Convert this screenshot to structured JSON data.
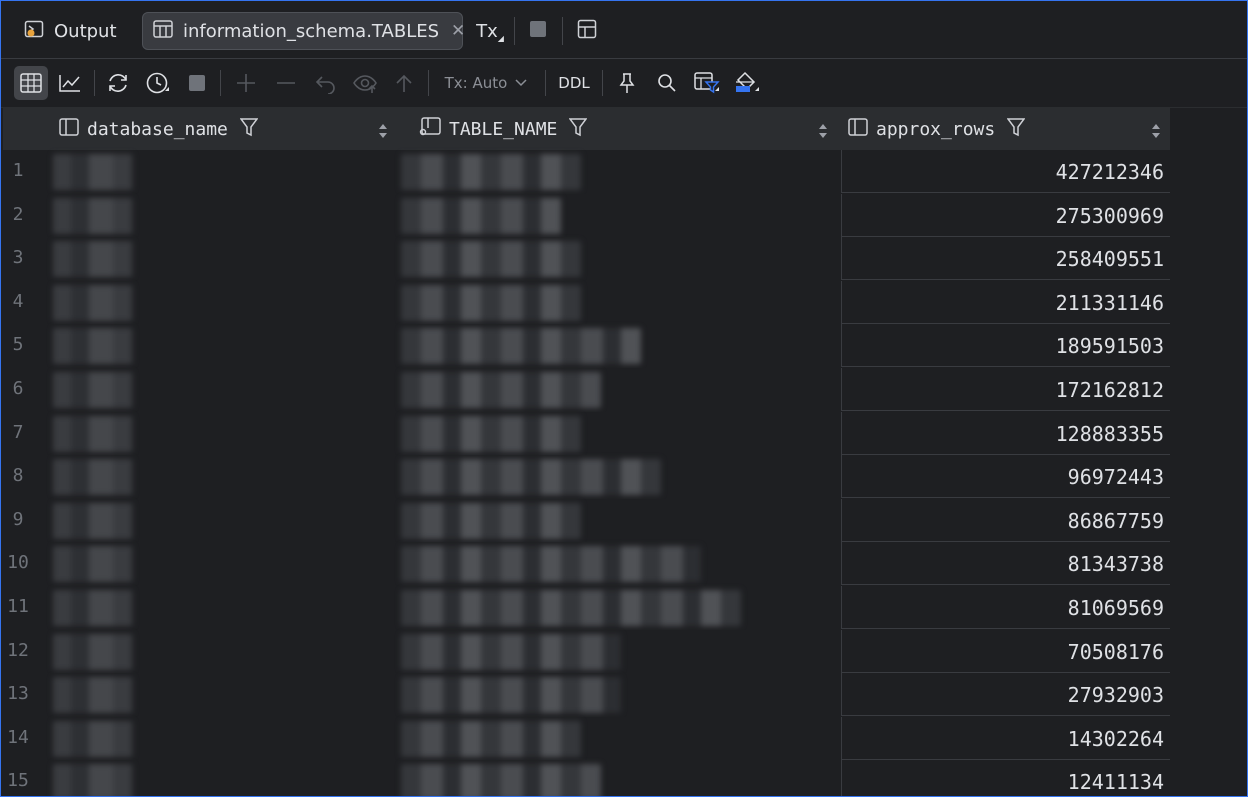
{
  "tabs": {
    "output_label": "Output",
    "active_label": "information_schema.TABLES",
    "tx_label": "Tx"
  },
  "toolbar": {
    "tx_mode": "Tx: Auto",
    "ddl_label": "DDL"
  },
  "columns": [
    {
      "name": "database_name"
    },
    {
      "name": "TABLE_NAME"
    },
    {
      "name": "approx_rows"
    }
  ],
  "rows": [
    {
      "num": "1",
      "approx_rows": "427212346"
    },
    {
      "num": "2",
      "approx_rows": "275300969"
    },
    {
      "num": "3",
      "approx_rows": "258409551"
    },
    {
      "num": "4",
      "approx_rows": "211331146"
    },
    {
      "num": "5",
      "approx_rows": "189591503"
    },
    {
      "num": "6",
      "approx_rows": "172162812"
    },
    {
      "num": "7",
      "approx_rows": "128883355"
    },
    {
      "num": "8",
      "approx_rows": "96972443"
    },
    {
      "num": "9",
      "approx_rows": "86867759"
    },
    {
      "num": "10",
      "approx_rows": "81343738"
    },
    {
      "num": "11",
      "approx_rows": "81069569"
    },
    {
      "num": "12",
      "approx_rows": "70508176"
    },
    {
      "num": "13",
      "approx_rows": "27932903"
    },
    {
      "num": "14",
      "approx_rows": "14302264"
    },
    {
      "num": "15",
      "approx_rows": "12411134"
    }
  ],
  "colors": {
    "accent": "#3574f0",
    "background": "#1e1f22",
    "header": "#2b2d30"
  }
}
